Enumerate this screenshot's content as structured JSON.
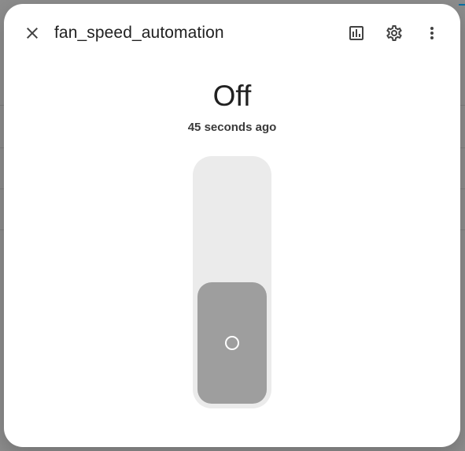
{
  "dialog": {
    "title": "fan_speed_automation",
    "state": "Off",
    "last_changed": "45 seconds ago"
  },
  "header": {
    "close_icon": "close-icon",
    "history_icon": "history-chart-icon",
    "settings_icon": "gear-icon",
    "menu_icon": "more-vertical-icon"
  },
  "toggle": {
    "state": "off",
    "thumb_icon": "circle-icon",
    "track_color": "#ebebeb",
    "thumb_color": "#9e9e9e"
  },
  "colors": {
    "text": "#212121",
    "icon": "#424242",
    "dialog_bg": "#ffffff"
  }
}
